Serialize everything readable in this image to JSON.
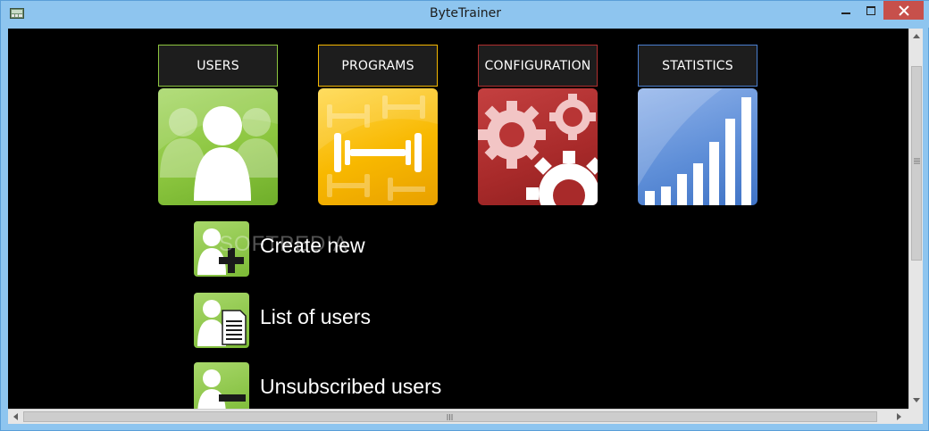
{
  "window": {
    "title": "ByteTrainer"
  },
  "nav": {
    "tabs": [
      {
        "label": "USERS",
        "color": "#8dc63f",
        "border": "#9be05a",
        "icon": "users-group-icon"
      },
      {
        "label": "PROGRAMS",
        "color": "#f5b800",
        "border": "#ffcc33",
        "icon": "dumbbell-icon"
      },
      {
        "label": "CONFIGURATION",
        "color": "#b02f2f",
        "border": "#cc4444",
        "icon": "gears-icon"
      },
      {
        "label": "STATISTICS",
        "color": "#4a7fcf",
        "border": "#6aa0ef",
        "icon": "bar-chart-icon"
      }
    ]
  },
  "actions": [
    {
      "label": "Create new",
      "icon": "add-user-icon"
    },
    {
      "label": "List of users",
      "icon": "user-list-icon"
    },
    {
      "label": "Unsubscribed users",
      "icon": "remove-user-icon"
    }
  ],
  "watermark": "SOFTPEDIA"
}
